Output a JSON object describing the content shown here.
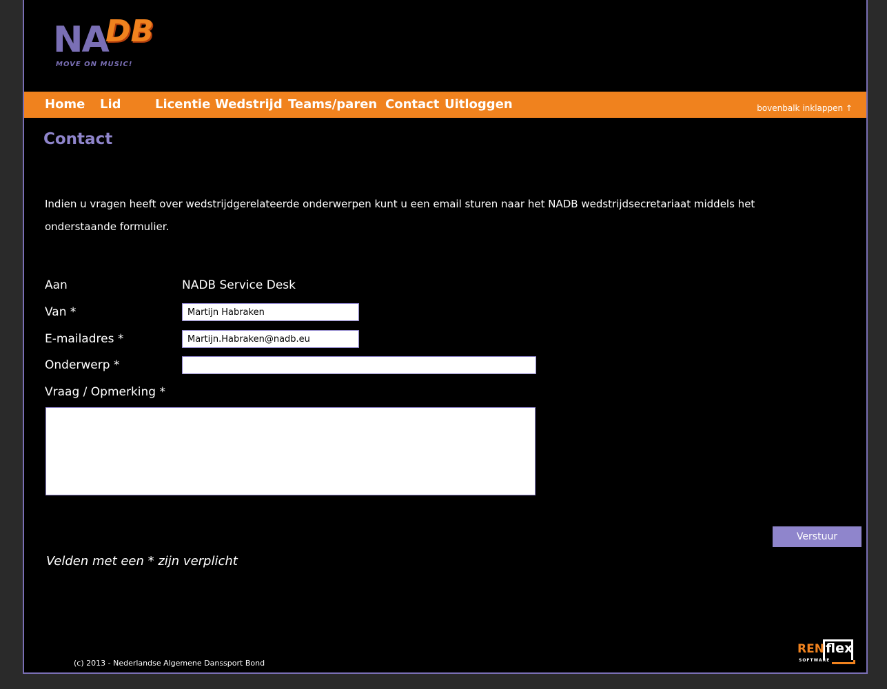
{
  "logo": {
    "letters_a": "NA",
    "letters_b": "DB",
    "tagline": "MOVE ON MUSIC!"
  },
  "nav": {
    "items": [
      "Home",
      "Lid",
      "Licentie",
      "Wedstrijd",
      "Teams/paren",
      "Contact",
      "Uitloggen"
    ],
    "collapse_label": "bovenbalk inklappen ↑"
  },
  "page": {
    "title": "Contact",
    "intro": "Indien u vragen heeft over wedstrijdgerelateerde onderwerpen kunt u een email sturen naar het NADB wedstrijdsecretariaat middels het onderstaande formulier."
  },
  "form": {
    "to_label": "Aan",
    "to_value": "NADB Service Desk",
    "from_label": "Van *",
    "from_value": "Martijn Habraken",
    "email_label": "E-mailadres *",
    "email_value": "Martijn.Habraken@nadb.eu",
    "subject_label": "Onderwerp *",
    "subject_value": "",
    "message_label": "Vraag / Opmerking *",
    "message_value": "",
    "submit_label": "Verstuur",
    "required_note": "Velden met een * zijn verplicht"
  },
  "footer": {
    "copyright": "(c) 2013 - Nederlandse Algemene Danssport Bond",
    "vendor_ren": "REN",
    "vendor_flex": "flex",
    "vendor_sub": "SOFTWARE"
  },
  "colors": {
    "accent_orange": "#f0821e",
    "accent_purple": "#8f85cc",
    "background": "#000000"
  }
}
